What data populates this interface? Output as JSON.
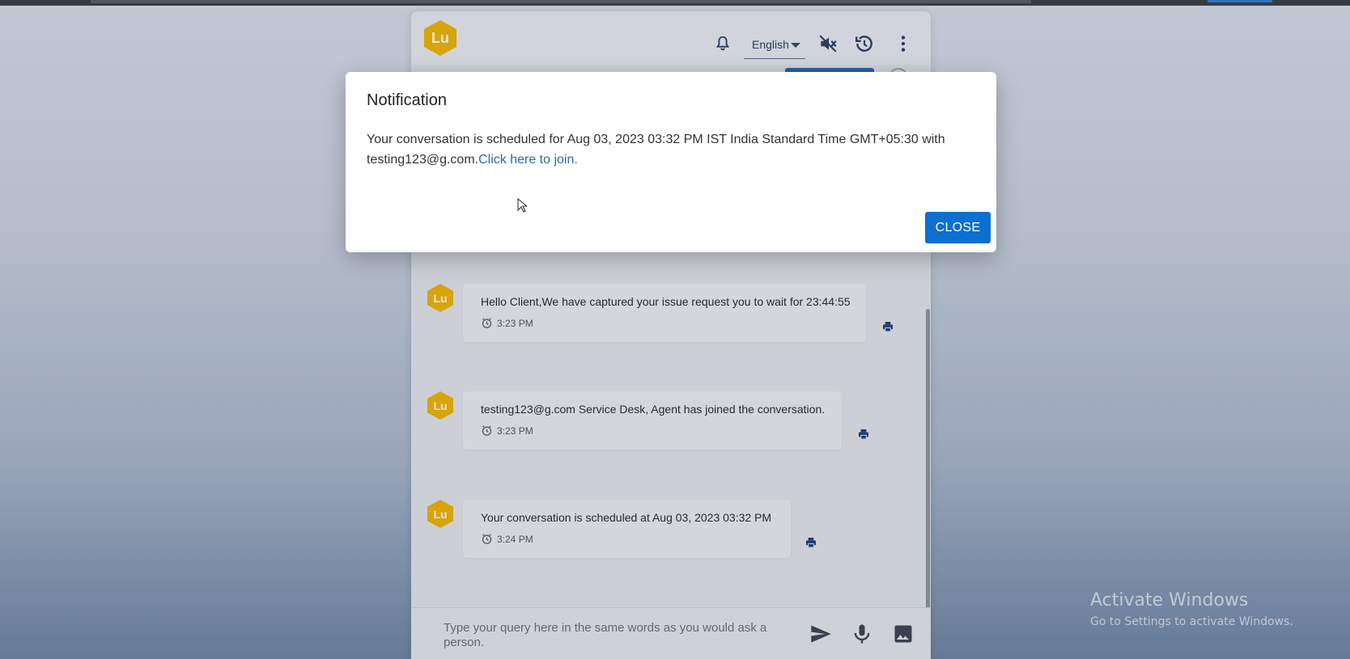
{
  "header": {
    "logo_text": "Lu",
    "language": "English",
    "icons": [
      "bell-icon",
      "mute-icon",
      "history-icon",
      "more-vert-icon"
    ]
  },
  "messages": [
    {
      "avatar": "Lu",
      "text": "Hello Client,We have captured your issue request you to wait for 23:44:55",
      "time": "3:23 PM"
    },
    {
      "avatar": "Lu",
      "text": "testing123@g.com Service Desk, Agent has joined the conversation.",
      "time": "3:23 PM"
    },
    {
      "avatar": "Lu",
      "text": "Your conversation is scheduled at Aug 03, 2023 03:32 PM",
      "time": "3:24 PM"
    }
  ],
  "composer": {
    "placeholder": "Type your query here in the same words as you would ask a person.",
    "icons": [
      "send-icon",
      "microphone-icon",
      "image-icon"
    ]
  },
  "modal": {
    "title": "Notification",
    "body": "Your conversation is scheduled for Aug 03, 2023 03:32 PM IST India Standard Time GMT+05:30 with testing123@g.com.",
    "link": "Click here to join.",
    "close_label": "CLOSE"
  },
  "watermark": {
    "line1": "Activate Windows",
    "line2": "Go to Settings to activate Windows."
  },
  "colors": {
    "accent": "#0d6fd0",
    "logo": "#f0b400",
    "link": "#2f64b6"
  }
}
